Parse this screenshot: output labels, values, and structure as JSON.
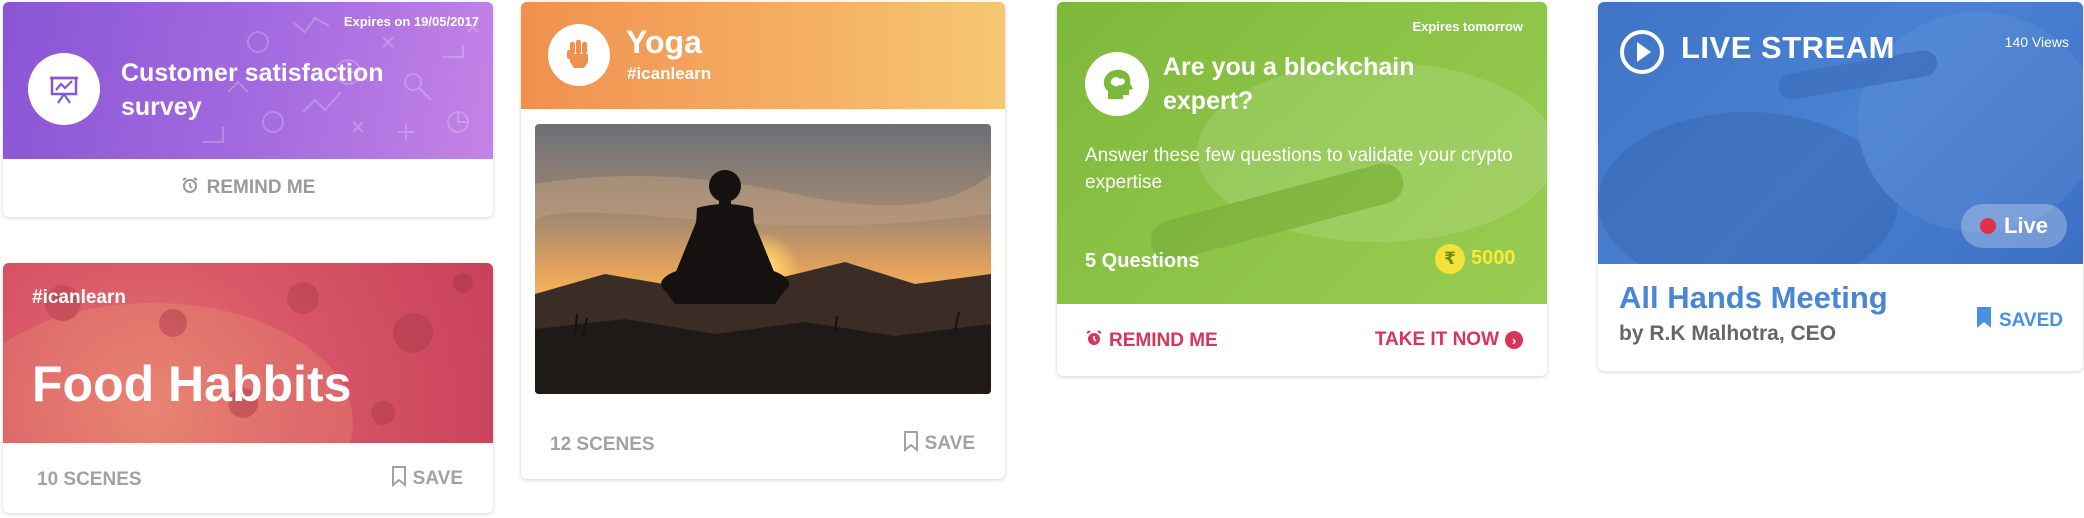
{
  "colors": {
    "survey_purple": "#8a55d4",
    "food_red": "#d95868",
    "yoga_orange": "#f0904f",
    "quiz_green": "#8cc447",
    "live_blue": "#4a82d3",
    "accent_pink": "#d9345a",
    "muted_grey": "#a2a2a2",
    "coin_yellow": "#f3e23a",
    "saved_blue": "#4a90e2"
  },
  "survey_card": {
    "expiry": "Expires on 19/05/2017",
    "title": "Customer satisfaction survey",
    "icon": "presentation-chart-icon",
    "remind_label": "REMIND ME",
    "remind_icon": "alarm-clock-icon"
  },
  "food_card": {
    "tag": "#icanlearn",
    "title": "Food Habbits",
    "scenes": "10 SCENES",
    "save_label": "SAVE",
    "save_icon": "bookmark-outline-icon"
  },
  "yoga_card": {
    "title": "Yoga",
    "tag": "#icanlearn",
    "icon": "raised-fist-icon",
    "image": "meditation-silhouette-sunset",
    "scenes": "12 SCENES",
    "save_label": "SAVE",
    "save_icon": "bookmark-outline-icon"
  },
  "quiz_card": {
    "expiry": "Expires tomorrow",
    "title": "Are you a blockchain expert?",
    "icon": "brain-head-icon",
    "description": "Answer these few questions to validate your crypto expertise",
    "question_count": "5 Questions",
    "coin_symbol": "₹",
    "points": "5000",
    "remind_label": "REMIND ME",
    "take_label": "TAKE IT NOW",
    "take_arrow": "›"
  },
  "live_card": {
    "title": "LIVE STREAM",
    "icon": "play-circle-icon",
    "views": "140 Views",
    "live_label": "Live",
    "meeting_title": "All Hands Meeting",
    "presenter": "by R.K Malhotra, CEO",
    "saved_label": "SAVED",
    "saved_icon": "bookmark-filled-icon"
  }
}
